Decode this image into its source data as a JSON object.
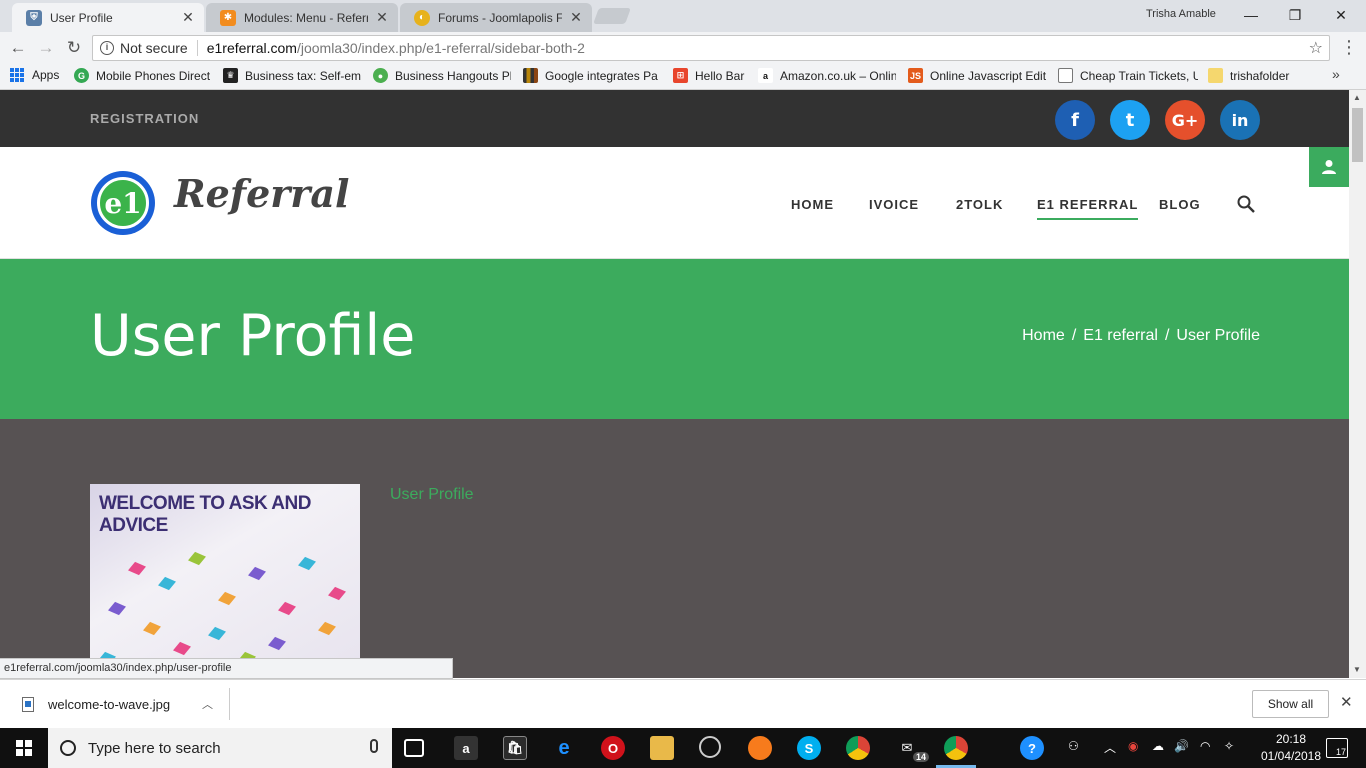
{
  "browser": {
    "tabs": [
      {
        "title": "User Profile",
        "active": true
      },
      {
        "title": "Modules: Menu - Referra",
        "active": false
      },
      {
        "title": "Forums - Joomlapolis Fo",
        "active": false
      }
    ],
    "profile_name": "Trisha Amable",
    "address": {
      "security": "Not secure",
      "domain": "e1referral.com",
      "path": "/joomla30/index.php/e1-referral/sidebar-both-2"
    },
    "bookmarks": [
      {
        "label": "Apps"
      },
      {
        "label": "Mobile Phones Direct"
      },
      {
        "label": "Business tax: Self-em"
      },
      {
        "label": "Business Hangouts Pl"
      },
      {
        "label": "Google integrates Pa"
      },
      {
        "label": "Hello Bar"
      },
      {
        "label": "Amazon.co.uk – Onlin"
      },
      {
        "label": "Online Javascript Edit"
      },
      {
        "label": "Cheap Train Tickets, U"
      },
      {
        "label": "trishafolder"
      }
    ],
    "status_url": "e1referral.com/joomla30/index.php/user-profile",
    "download": {
      "filename": "welcome-to-wave.jpg",
      "show_all": "Show all"
    }
  },
  "site": {
    "topbar": {
      "registration": "REGISTRATION"
    },
    "social": [
      {
        "glyph": "f",
        "color": "#1e5fb3"
      },
      {
        "glyph": "t",
        "color": "#1da1f2"
      },
      {
        "glyph": "G+",
        "color": "#e5502c"
      },
      {
        "glyph": "in",
        "color": "#1a72b5"
      }
    ],
    "logo_text": "Referral",
    "logo_mark": "e1",
    "nav": [
      {
        "label": "HOME"
      },
      {
        "label": "IVOICE"
      },
      {
        "label": "2TOLK"
      },
      {
        "label": "E1 REFERRAL",
        "active": true
      },
      {
        "label": "BLOG"
      }
    ],
    "accent_color": "#3cab5d",
    "banner": {
      "title": "User Profile",
      "breadcrumb": [
        "Home",
        "E1 referral",
        "User Profile"
      ]
    },
    "profile": {
      "image_caption": "WELCOME TO ASK AND ADVICE",
      "link": "User Profile"
    }
  },
  "taskbar": {
    "search_placeholder": "Type here to search",
    "mail_badge": "14",
    "time": "20:18",
    "date": "01/04/2018",
    "notifications": "17"
  }
}
